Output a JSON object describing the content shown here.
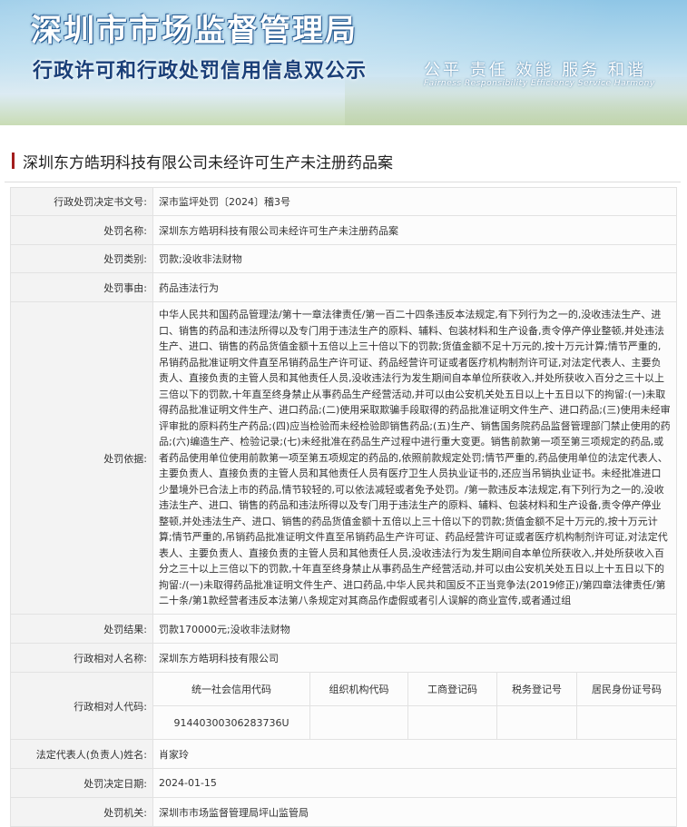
{
  "header": {
    "title": "深圳市市场监督管理局",
    "subtitle": "行政许可和行政处罚信用信息双公示",
    "motto": "公平 责任 效能 服务 和谐",
    "motto_en": "Fairness Responsibility Efficiency Service Harmony"
  },
  "case_title": "深圳东方皓玥科技有限公司未经许可生产未注册药品案",
  "rows": {
    "doc_no": {
      "label": "行政处罚决定书文号:",
      "value": "深市监坪处罚〔2024〕稽3号"
    },
    "case_name": {
      "label": "处罚名称:",
      "value": "深圳东方皓玥科技有限公司未经许可生产未注册药品案"
    },
    "category": {
      "label": "处罚类别:",
      "value": "罚款;没收非法财物"
    },
    "cause": {
      "label": "处罚事由:",
      "value": "药品违法行为"
    },
    "basis": {
      "label": "处罚依据:",
      "value": "中华人民共和国药品管理法/第十一章法律责任/第一百二十四条违反本法规定,有下列行为之一的,没收违法生产、进口、销售的药品和违法所得以及专门用于违法生产的原料、辅料、包装材料和生产设备,责令停产停业整顿,并处违法生产、进口、销售的药品货值金额十五倍以上三十倍以下的罚款;货值金额不足十万元的,按十万元计算;情节严重的,吊销药品批准证明文件直至吊销药品生产许可证、药品经营许可证或者医疗机构制剂许可证,对法定代表人、主要负责人、直接负责的主管人员和其他责任人员,没收违法行为发生期间自本单位所获收入,并处所获收入百分之三十以上三倍以下的罚款,十年直至终身禁止从事药品生产经营活动,并可以由公安机关处五日以上十五日以下的拘留:(一)未取得药品批准证明文件生产、进口药品;(二)使用采取欺骗手段取得的药品批准证明文件生产、进口药品;(三)使用未经审评审批的原料药生产药品;(四)应当检验而未经检验即销售药品;(五)生产、销售国务院药品监督管理部门禁止使用的药品;(六)编造生产、检验记录;(七)未经批准在药品生产过程中进行重大变更。销售前款第一项至第三项规定的药品,或者药品使用单位使用前款第一项至第五项规定的药品的,依照前款规定处罚;情节严重的,药品使用单位的法定代表人、主要负责人、直接负责的主管人员和其他责任人员有医疗卫生人员执业证书的,还应当吊销执业证书。未经批准进口少量境外已合法上市的药品,情节较轻的,可以依法减轻或者免予处罚。/第一款违反本法规定,有下列行为之一的,没收违法生产、进口、销售的药品和违法所得以及专门用于违法生产的原料、辅料、包装材料和生产设备,责令停产停业整顿,并处违法生产、进口、销售的药品货值金额十五倍以上三十倍以下的罚款;货值金额不足十万元的,按十万元计算;情节严重的,吊销药品批准证明文件直至吊销药品生产许可证、药品经营许可证或者医疗机构制剂许可证,对法定代表人、主要负责人、直接负责的主管人员和其他责任人员,没收违法行为发生期间自本单位所获收入,并处所获收入百分之三十以上三倍以下的罚款,十年直至终身禁止从事药品生产经营活动,并可以由公安机关处五日以上十五日以下的拘留:/(一)未取得药品批准证明文件生产、进口药品,中华人民共和国反不正当竞争法(2019修正)/第四章法律责任/第二十条/第1款经营者违反本法第八条规定对其商品作虚假或者引人误解的商业宣传,或者通过组"
    },
    "result": {
      "label": "处罚结果:",
      "value": "罚款170000元;没收非法财物"
    },
    "party_name": {
      "label": "行政相对人名称:",
      "value": "深圳东方皓玥科技有限公司"
    },
    "party_code": {
      "label": "行政相对人代码:",
      "headers": [
        "统一社会信用代码",
        "组织机构代码",
        "工商登记码",
        "税务登记号",
        "居民身份证号码"
      ],
      "values": [
        "91440300306283736U",
        "",
        "",
        "",
        ""
      ]
    },
    "legal_rep": {
      "label": "法定代表人(负责人)姓名:",
      "value": "肖家玲"
    },
    "decision_date": {
      "label": "处罚决定日期:",
      "value": "2024-01-15"
    },
    "authority": {
      "label": "处罚机关:",
      "value": "深圳市市场监督管理局坪山监管局"
    }
  }
}
